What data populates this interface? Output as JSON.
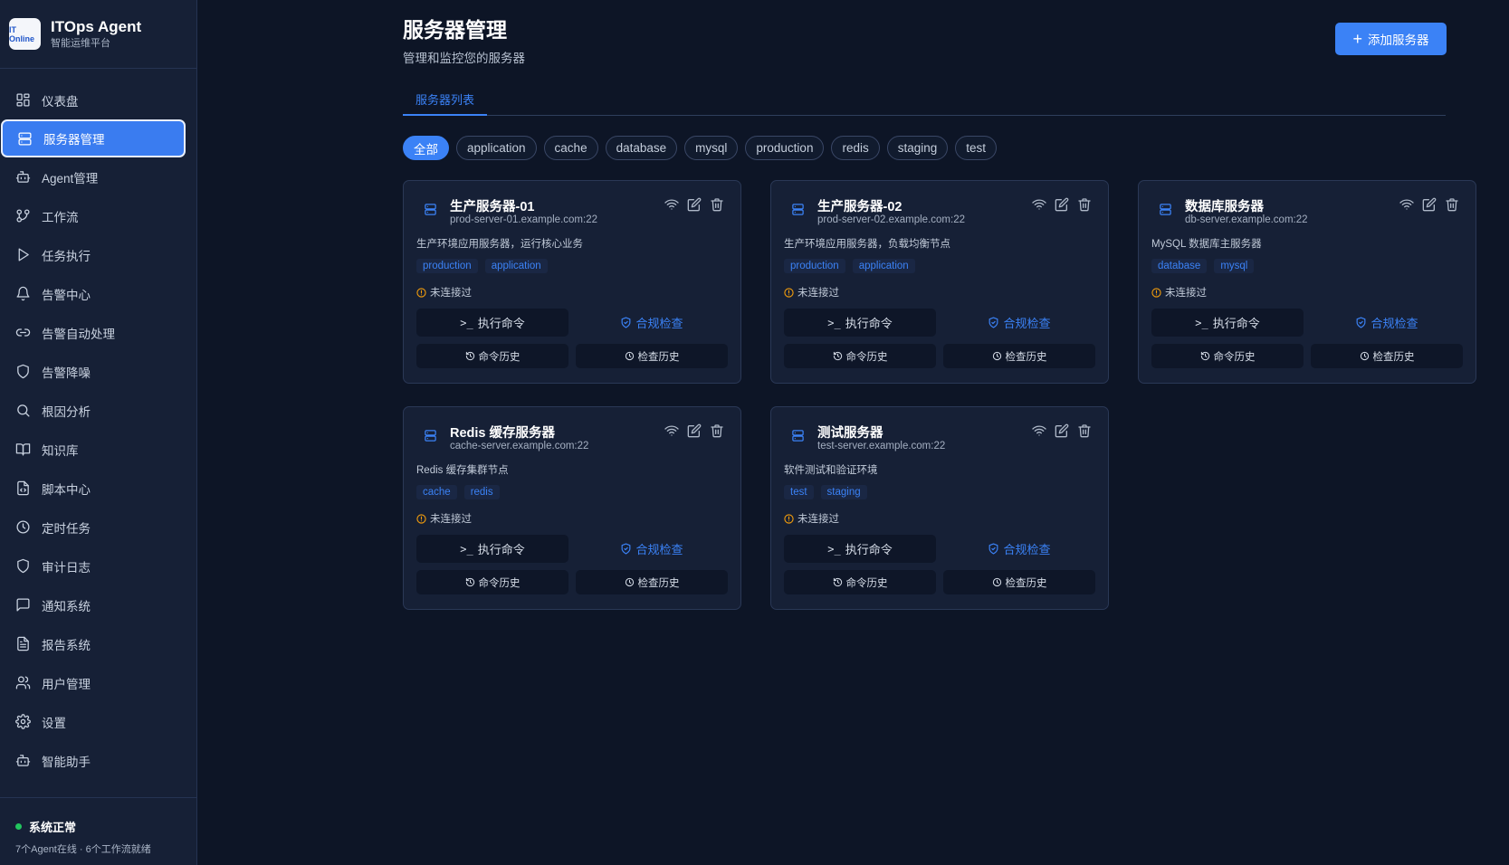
{
  "brand": {
    "logo_text": "IT Online",
    "title": "ITOps Agent",
    "subtitle": "智能运维平台"
  },
  "sidebar": {
    "items": [
      {
        "label": "仪表盘",
        "icon": "dashboard-icon"
      },
      {
        "label": "服务器管理",
        "icon": "server-icon",
        "active": true
      },
      {
        "label": "Agent管理",
        "icon": "bot-icon"
      },
      {
        "label": "工作流",
        "icon": "workflow-icon"
      },
      {
        "label": "任务执行",
        "icon": "play-icon"
      },
      {
        "label": "告警中心",
        "icon": "bell-icon"
      },
      {
        "label": "告警自动处理",
        "icon": "link-icon"
      },
      {
        "label": "告警降噪",
        "icon": "shield-icon"
      },
      {
        "label": "根因分析",
        "icon": "search-icon"
      },
      {
        "label": "知识库",
        "icon": "book-icon"
      },
      {
        "label": "脚本中心",
        "icon": "file-code-icon"
      },
      {
        "label": "定时任务",
        "icon": "clock-icon"
      },
      {
        "label": "审计日志",
        "icon": "shield-icon"
      },
      {
        "label": "通知系统",
        "icon": "message-icon"
      },
      {
        "label": "报告系统",
        "icon": "file-text-icon"
      },
      {
        "label": "用户管理",
        "icon": "users-icon"
      },
      {
        "label": "设置",
        "icon": "gear-icon"
      },
      {
        "label": "智能助手",
        "icon": "bot-icon"
      }
    ],
    "footer": {
      "status": "系统正常",
      "detail": "7个Agent在线 · 6个工作流就绪"
    }
  },
  "header": {
    "title": "服务器管理",
    "subtitle": "管理和监控您的服务器",
    "add_button": "添加服务器"
  },
  "tabs": [
    {
      "label": "服务器列表",
      "active": true
    }
  ],
  "filters": [
    "全部",
    "application",
    "cache",
    "database",
    "mysql",
    "production",
    "redis",
    "staging",
    "test"
  ],
  "active_filter": "全部",
  "card_labels": {
    "status": "未连接过",
    "exec": "执行命令",
    "check": "合规检查",
    "cmd_history": "命令历史",
    "check_history": "检查历史"
  },
  "servers": [
    {
      "name": "生产服务器-01",
      "host": "prod-server-01.example.com:22",
      "desc": "生产环境应用服务器，运行核心业务",
      "tags": [
        "production",
        "application"
      ]
    },
    {
      "name": "生产服务器-02",
      "host": "prod-server-02.example.com:22",
      "desc": "生产环境应用服务器，负载均衡节点",
      "tags": [
        "production",
        "application"
      ]
    },
    {
      "name": "数据库服务器",
      "host": "db-server.example.com:22",
      "desc": "MySQL 数据库主服务器",
      "tags": [
        "database",
        "mysql"
      ]
    },
    {
      "name": "Redis 缓存服务器",
      "host": "cache-server.example.com:22",
      "desc": "Redis 缓存集群节点",
      "tags": [
        "cache",
        "redis"
      ]
    },
    {
      "name": "测试服务器",
      "host": "test-server.example.com:22",
      "desc": "软件测试和验证环境",
      "tags": [
        "test",
        "staging"
      ]
    }
  ],
  "colors": {
    "accent": "#3b82f6",
    "background": "#0d1526",
    "sidebar": "#162036",
    "status_ok": "#22c55e",
    "warning": "#f59e0b"
  }
}
